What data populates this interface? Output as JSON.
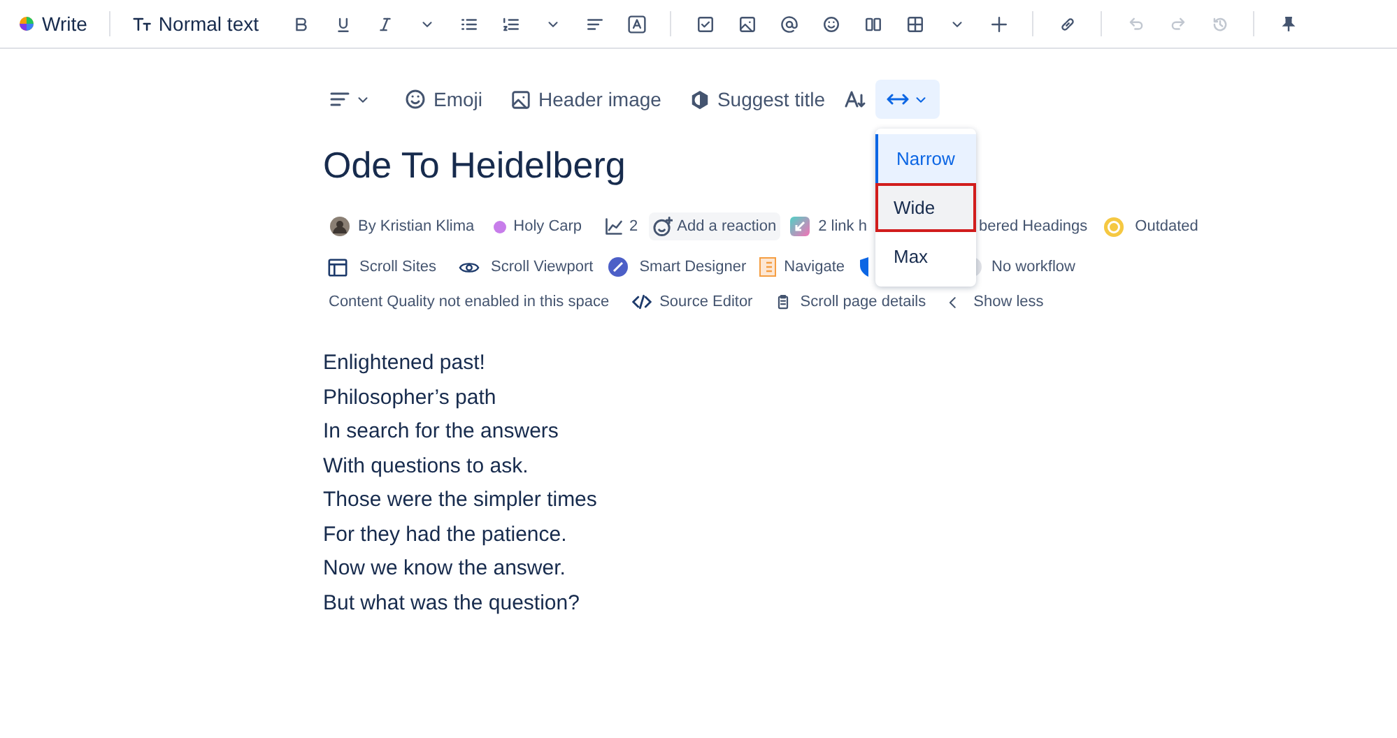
{
  "toolbar": {
    "mode_label": "Write",
    "style_label": "Normal text",
    "tools": [
      {
        "kind": "bold",
        "disabled": false
      },
      {
        "kind": "underline",
        "disabled": false
      },
      {
        "kind": "italic",
        "disabled": false
      },
      {
        "kind": "caret",
        "disabled": false
      },
      {
        "kind": "bullets",
        "disabled": false
      },
      {
        "kind": "numbers",
        "disabled": false
      },
      {
        "kind": "caret",
        "disabled": false
      },
      {
        "kind": "align",
        "disabled": false
      },
      {
        "kind": "color",
        "disabled": false
      },
      {
        "kind": "sep",
        "disabled": false
      },
      {
        "kind": "task",
        "disabled": false
      },
      {
        "kind": "image",
        "disabled": false
      },
      {
        "kind": "mention",
        "disabled": false
      },
      {
        "kind": "emoji",
        "disabled": false
      },
      {
        "kind": "columns",
        "disabled": false
      },
      {
        "kind": "table",
        "disabled": false
      },
      {
        "kind": "caret",
        "disabled": false
      },
      {
        "kind": "plus",
        "disabled": false
      },
      {
        "kind": "sep",
        "disabled": false
      },
      {
        "kind": "link",
        "disabled": false
      },
      {
        "kind": "sep",
        "disabled": false
      },
      {
        "kind": "undo",
        "disabled": true
      },
      {
        "kind": "redo",
        "disabled": true
      },
      {
        "kind": "history",
        "disabled": true
      },
      {
        "kind": "sep",
        "disabled": false
      },
      {
        "kind": "pin",
        "disabled": false
      }
    ]
  },
  "page_toolbar": {
    "emoji": "Emoji",
    "header_image": "Header image",
    "suggest_title": "Suggest title"
  },
  "width_menu": {
    "options": [
      {
        "label": "Narrow",
        "selected": true,
        "highlighted": false
      },
      {
        "label": "Wide",
        "selected": false,
        "highlighted": true
      },
      {
        "label": "Max",
        "selected": false,
        "highlighted": false
      }
    ]
  },
  "title": "Ode To Heidelberg",
  "byline": {
    "author": "By Kristian Klima",
    "space": {
      "label": "Holy Carp",
      "color": "#c77dea"
    },
    "views": "2",
    "reaction": "Add a reaction",
    "links": "2 link h",
    "headings": "bered Headings",
    "status": "Outdated"
  },
  "apps": {
    "scroll_sites": "Scroll Sites",
    "scroll_viewport": "Scroll Viewport",
    "smart_designer": "Smart Designer",
    "navigate": "Navigate",
    "workflow": "No workflow"
  },
  "meta": {
    "quality": "Content Quality not enabled in this space",
    "source_editor": "Source Editor",
    "page_details": "Scroll page details",
    "show_less": "Show less"
  },
  "body": [
    "Enlightened past!",
    "Philosopher’s path",
    "In search for the answers",
    "With questions to ask.",
    "Those were the simpler times",
    "For they had the patience.",
    "Now we know the answer.",
    "But what was the question?"
  ]
}
